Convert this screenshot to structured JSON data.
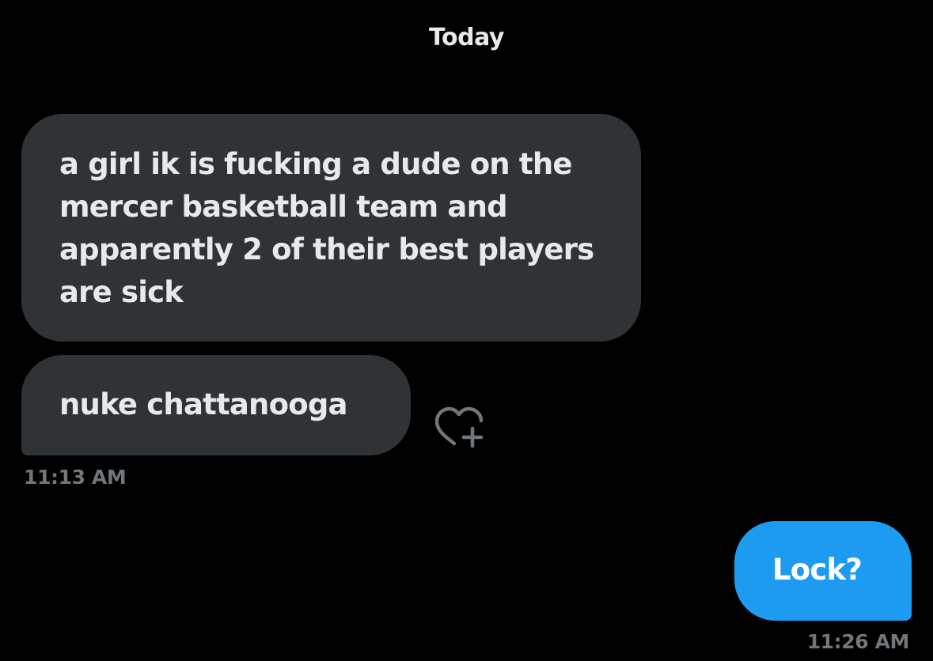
{
  "conversation": {
    "date_header": "Today",
    "messages": [
      {
        "direction": "received",
        "text": "a girl ik is fucking a dude on the mercer basketball team and apparently 2 of their best players are sick"
      },
      {
        "direction": "received",
        "text": "nuke chattanooga",
        "reaction_button": "heart-plus-icon"
      },
      {
        "direction": "sent",
        "text": "Lock?"
      }
    ],
    "timestamps": {
      "received_group": "11:13 AM",
      "sent_group": "11:26 AM"
    }
  },
  "colors": {
    "background": "#000000",
    "received_bubble": "#2f3336",
    "sent_bubble": "#1d9bf0",
    "primary_text": "#e7e9ea",
    "secondary_text": "#71767b"
  }
}
